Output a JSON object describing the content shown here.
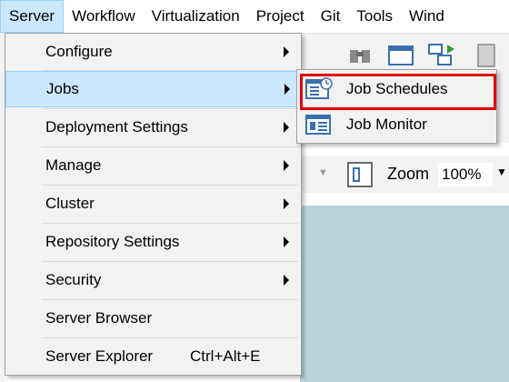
{
  "menubar": {
    "items": [
      {
        "label": "Server",
        "state": "open"
      },
      {
        "label": "Workflow"
      },
      {
        "label": "Virtualization"
      },
      {
        "label": "Project"
      },
      {
        "label": "Git"
      },
      {
        "label": "Tools"
      },
      {
        "label": "Wind"
      }
    ]
  },
  "toolbar": {
    "zoom_label": "Zoom",
    "zoom_value": "100%"
  },
  "server_menu": {
    "items": [
      {
        "label": "Configure",
        "has_submenu": true
      },
      {
        "label": "Jobs",
        "has_submenu": true,
        "state": "highlighted"
      },
      {
        "label": "Deployment Settings",
        "has_submenu": true
      },
      {
        "label": "Manage",
        "has_submenu": true
      },
      {
        "label": "Cluster",
        "has_submenu": true
      },
      {
        "label": "Repository Settings",
        "has_submenu": true
      },
      {
        "label": "Security",
        "has_submenu": true
      },
      {
        "label": "Server Browser",
        "has_submenu": false
      },
      {
        "label": "Server Explorer",
        "shortcut": "Ctrl+Alt+E",
        "has_submenu": false
      }
    ]
  },
  "jobs_submenu": {
    "items": [
      {
        "label": "Job Schedules",
        "icon": "job-schedules-icon",
        "annotated": true
      },
      {
        "label": "Job Monitor",
        "icon": "job-monitor-icon"
      }
    ]
  },
  "colors": {
    "highlight_fill": "#cce8ff",
    "highlight_border": "#99d1ff",
    "annotation_box": "#e00000",
    "workspace": "#b9d3dd",
    "menu_bg": "#f2f2f2"
  }
}
